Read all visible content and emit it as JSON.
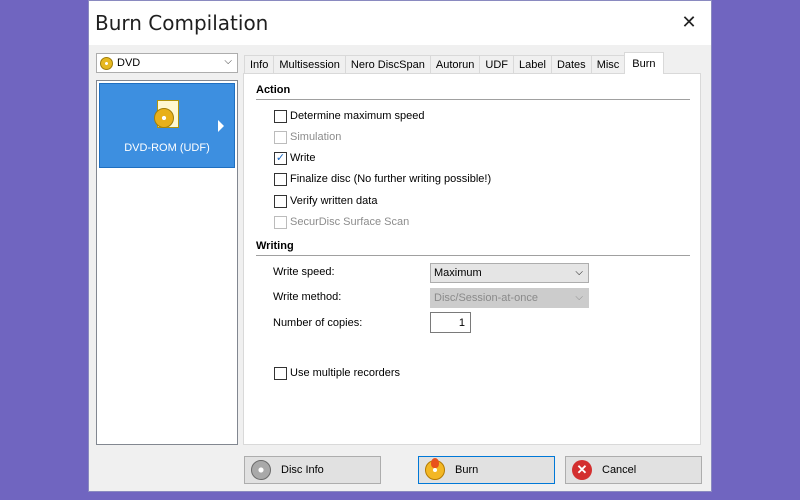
{
  "window": {
    "title": "Burn Compilation",
    "close_glyph": "✕"
  },
  "disc_type": {
    "selected": "DVD",
    "icon": "dvd-disc-icon"
  },
  "compilation_list": {
    "items": [
      {
        "label": "DVD-ROM (UDF)",
        "icon": "dvd-rom-icon"
      }
    ]
  },
  "tabs": [
    {
      "label": "Info"
    },
    {
      "label": "Multisession"
    },
    {
      "label": "Nero DiscSpan"
    },
    {
      "label": "Autorun"
    },
    {
      "label": "UDF"
    },
    {
      "label": "Label"
    },
    {
      "label": "Dates"
    },
    {
      "label": "Misc"
    },
    {
      "label": "Burn",
      "active": true
    }
  ],
  "action": {
    "heading": "Action",
    "options": [
      {
        "label": "Determine maximum speed",
        "checked": false,
        "enabled": true
      },
      {
        "label": "Simulation",
        "checked": false,
        "enabled": false
      },
      {
        "label": "Write",
        "checked": true,
        "enabled": true
      },
      {
        "label": "Finalize disc (No further writing possible!)",
        "checked": false,
        "enabled": true
      },
      {
        "label": "Verify written data",
        "checked": false,
        "enabled": true
      },
      {
        "label": "SecurDisc Surface Scan",
        "checked": false,
        "enabled": false
      }
    ]
  },
  "writing": {
    "heading": "Writing",
    "write_speed_label": "Write speed:",
    "write_speed_value": "Maximum",
    "write_method_label": "Write method:",
    "write_method_value": "Disc/Session-at-once",
    "copies_label": "Number of copies:",
    "copies_value": "1",
    "multi_recorders_label": "Use multiple recorders",
    "multi_recorders_checked": false
  },
  "buttons": {
    "disc_info": "Disc Info",
    "burn": "Burn",
    "cancel": "Cancel"
  },
  "colors": {
    "background": "#7065c0",
    "selection": "#3d8fe0",
    "accent": "#0078d7"
  }
}
